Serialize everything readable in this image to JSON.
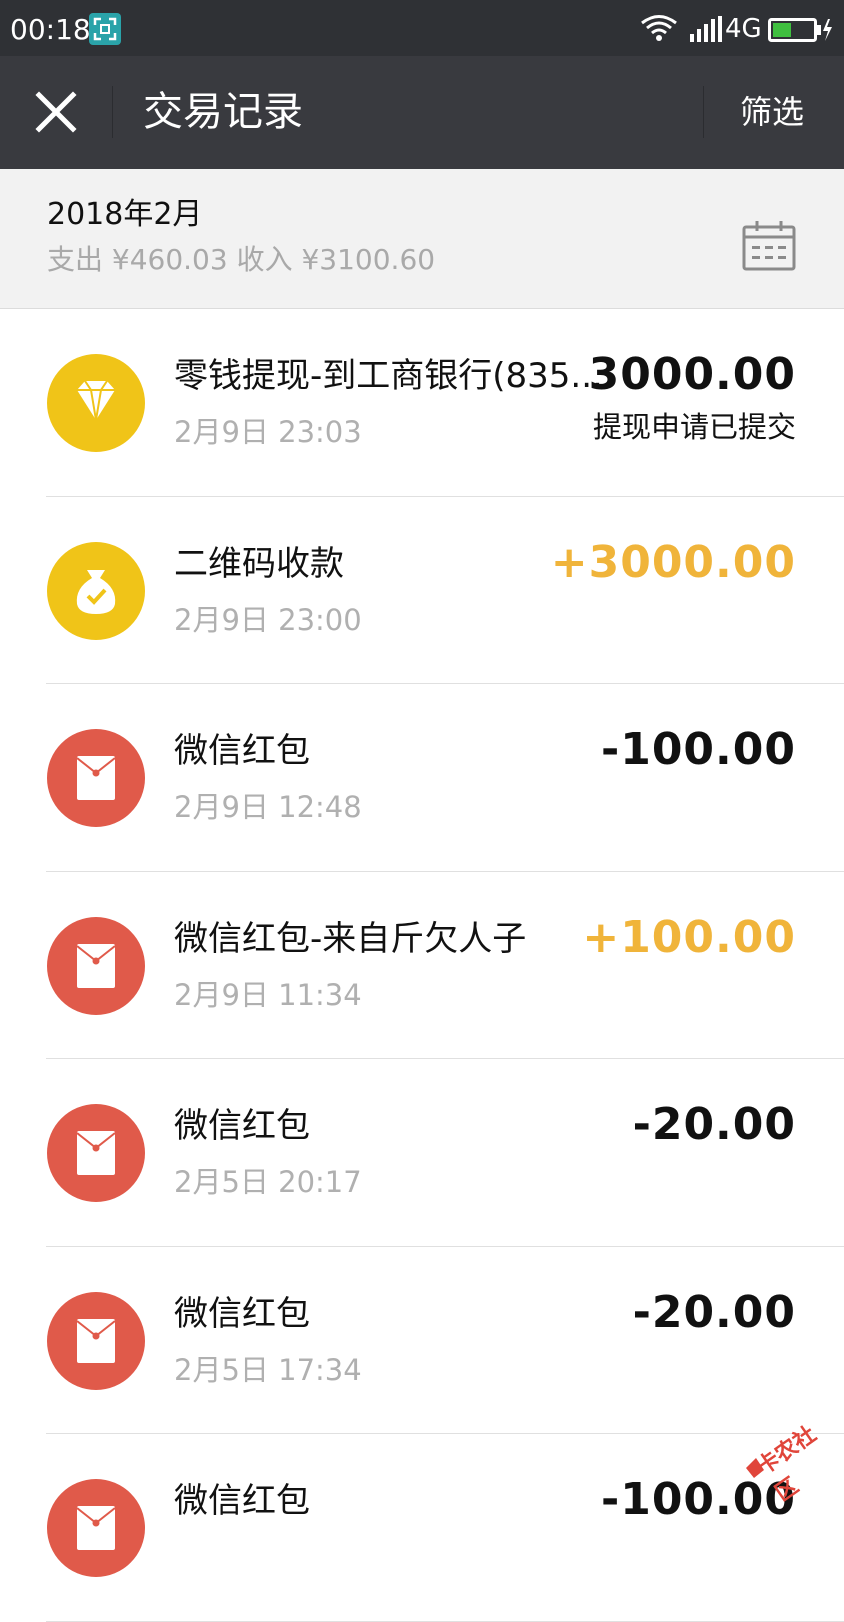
{
  "status_bar": {
    "time": "00:18",
    "network": "4G",
    "scan_icon": "scan-icon",
    "wifi_icon": "wifi-icon",
    "signal_icon": "signal-icon",
    "battery_icon": "battery-charging-icon"
  },
  "nav": {
    "title": "交易记录",
    "filter_label": "筛选",
    "close_icon": "close-icon"
  },
  "month": {
    "title": "2018年2月",
    "summary": "支出 ¥460.03 收入 ¥3100.60",
    "calendar_icon": "calendar-icon"
  },
  "transactions": [
    {
      "title": "零钱提现-到工商银行(835...",
      "date": "2月9日 23:03",
      "amount": "3000.00",
      "status": "提现申请已提交",
      "type": "withdraw",
      "icon": "diamond-icon",
      "icon_color": "#f0c418",
      "income": false
    },
    {
      "title": "二维码收款",
      "date": "2月9日 23:00",
      "amount": "+3000.00",
      "status": "",
      "type": "qr-receive",
      "icon": "money-bag-icon",
      "icon_color": "#f0c418",
      "income": true
    },
    {
      "title": "微信红包",
      "date": "2月9日 12:48",
      "amount": "-100.00",
      "status": "",
      "type": "red-packet",
      "icon": "red-packet-icon",
      "icon_color": "#e05a4a",
      "income": false
    },
    {
      "title": "微信红包-来自斤欠人子",
      "date": "2月9日 11:34",
      "amount": "+100.00",
      "status": "",
      "type": "red-packet",
      "icon": "red-packet-icon",
      "icon_color": "#e05a4a",
      "income": true
    },
    {
      "title": "微信红包",
      "date": "2月5日 20:17",
      "amount": "-20.00",
      "status": "",
      "type": "red-packet",
      "icon": "red-packet-icon",
      "icon_color": "#e05a4a",
      "income": false
    },
    {
      "title": "微信红包",
      "date": "2月5日 17:34",
      "amount": "-20.00",
      "status": "",
      "type": "red-packet",
      "icon": "red-packet-icon",
      "icon_color": "#e05a4a",
      "income": false
    },
    {
      "title": "微信红包",
      "date": "",
      "amount": "-100.00",
      "status": "",
      "type": "red-packet",
      "icon": "red-packet-icon",
      "icon_color": "#e05a4a",
      "income": false
    }
  ],
  "watermark": {
    "text": "卡农社区"
  },
  "colors": {
    "nav_bg": "#393a3f",
    "status_bg": "#2f3135",
    "income": "#f0b43a",
    "yellow_icon": "#f0c418",
    "red_icon": "#e05a4a"
  }
}
